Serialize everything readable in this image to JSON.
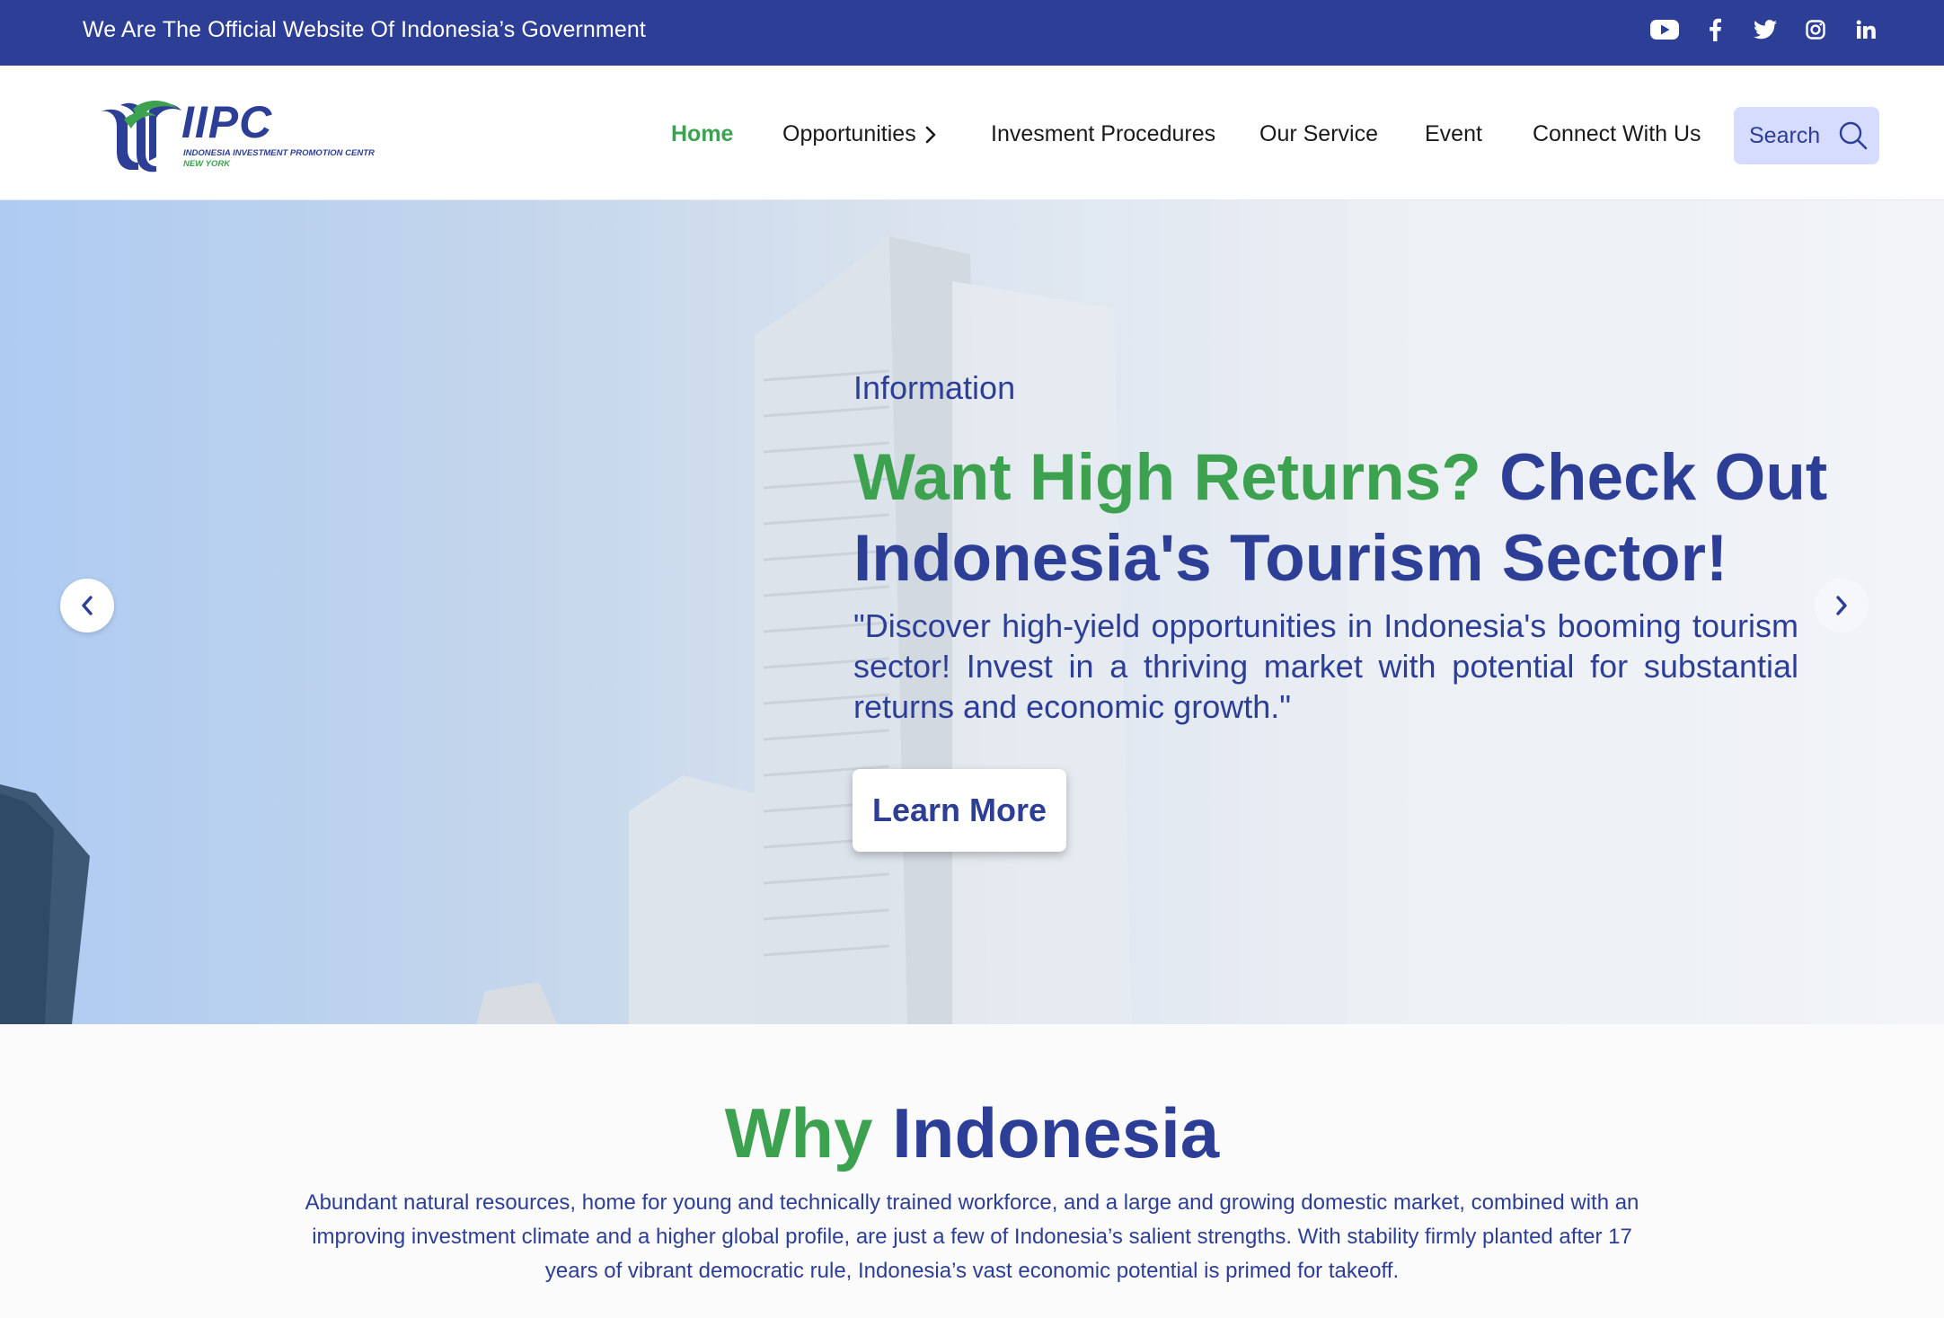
{
  "topbar": {
    "text": "We Are The Official Website Of Indonesia’s Government",
    "social_icons": [
      "youtube-icon",
      "facebook-icon",
      "twitter-icon",
      "instagram-icon",
      "linkedin-icon"
    ]
  },
  "logo": {
    "word": "IIPC",
    "subtitle": "INDONESIA INVESTMENT PROMOTION CENTR",
    "city": "NEW YORK"
  },
  "nav": {
    "items": [
      {
        "label": "Home",
        "active": true
      },
      {
        "label": "Opportunities",
        "has_submenu": true
      },
      {
        "label": "Invesment Procedures"
      },
      {
        "label": "Our Service"
      },
      {
        "label": "Event"
      },
      {
        "label": "Connect With Us"
      }
    ],
    "search_label": "Search"
  },
  "hero": {
    "eyebrow": "Information",
    "title_green": "Want High Returns?",
    "title_blue": "Check Out Indonesia's Tourism Sector!",
    "description": "\"Discover high-yield opportunities in Indonesia's booming tourism sector! Invest in a thriving market with potential for substantial returns and economic growth.\"",
    "button_label": "Learn More"
  },
  "why": {
    "title_green": "Why",
    "title_blue": "Indonesia",
    "text": "Abundant natural resources, home for young and technically trained workforce, and a large and growing domestic market, combined with an improving investment climate and a higher global profile, are just a few of Indonesia’s salient strengths. With stability firmly planted after 17 years of vibrant democratic rule, Indonesia’s vast economic potential is primed for takeoff."
  },
  "colors": {
    "brand_blue": "#2d3e96",
    "brand_green": "#3da24f",
    "search_bg": "#d6dcff"
  }
}
